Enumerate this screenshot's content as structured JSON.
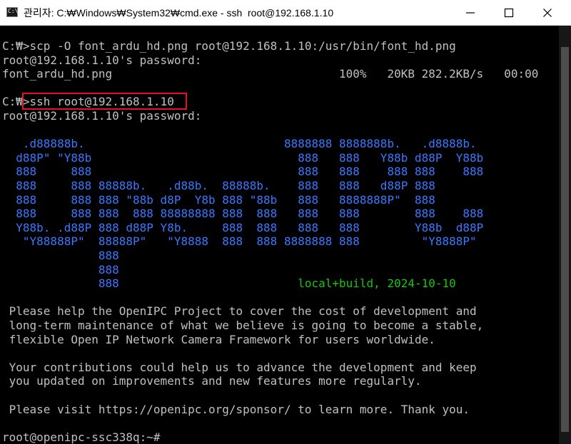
{
  "window": {
    "title": "관리자: C:₩Windows₩System32₩cmd.exe - ssh  root@192.168.1.10",
    "icon": "cmd-icon",
    "icon_text": "C:\\",
    "controls": [
      "minimize-icon",
      "maximize-icon",
      "close-icon"
    ]
  },
  "colors": {
    "background": "#000000",
    "text": "#c0c0c0",
    "banner_blue": "#3b78ff",
    "build_green": "#16c60c",
    "highlight_red": "#e81123"
  },
  "terminal": {
    "lines": [
      {
        "text": "C:₩>scp -O font_ardu_hd.png root@192.168.1.10:/usr/bin/font_hd.png",
        "color": "text"
      },
      {
        "text": "root@192.168.1.10's password:",
        "color": "text"
      },
      {
        "text": "font_ardu_hd.png                                 100%   20KB 282.2KB/s   00:00",
        "color": "text"
      },
      {
        "text": "",
        "color": "text"
      },
      {
        "text": "C:₩>ssh root@192.168.1.10",
        "color": "text"
      },
      {
        "text": "root@192.168.1.10's password:",
        "color": "text"
      },
      {
        "text": "",
        "color": "text"
      },
      {
        "text": "   .d88888b.                             8888888 8888888b.   .d8888b.",
        "color": "banner_blue"
      },
      {
        "text": "  d88P\" \"Y88b                              888   888   Y88b d88P  Y88b",
        "color": "banner_blue"
      },
      {
        "text": "  888     888                              888   888    888 888    888",
        "color": "banner_blue"
      },
      {
        "text": "  888     888 88888b.   .d88b.  88888b.    888   888   d88P 888",
        "color": "banner_blue"
      },
      {
        "text": "  888     888 888 \"88b d8P  Y8b 888 \"88b   888   8888888P\"  888",
        "color": "banner_blue"
      },
      {
        "text": "  888     888 888  888 88888888 888  888   888   888        888    888",
        "color": "banner_blue"
      },
      {
        "text": "  Y88b. .d88P 888 d88P Y8b.     888  888   888   888        Y88b  d88P",
        "color": "banner_blue"
      },
      {
        "text": "   \"Y88888P\"  88888P\"   \"Y8888  888  888 8888888 888         \"Y8888P\"",
        "color": "banner_blue"
      },
      {
        "text": "              888",
        "color": "banner_blue"
      },
      {
        "text": "              888",
        "color": "banner_blue"
      },
      {
        "text": "              888                          local+build, 2024-10-10",
        "color": "build_green",
        "prefix_color": "banner_blue"
      },
      {
        "text": " Please help the OpenIPC Project to cover the cost of development and",
        "color": "text"
      },
      {
        "text": " long-term maintenance of what we believe is going to become a stable,",
        "color": "text"
      },
      {
        "text": " flexible Open IP Network Camera Framework for users worldwide.",
        "color": "text"
      },
      {
        "text": "",
        "color": "text"
      },
      {
        "text": " Your contributions could help us to advance the development and keep",
        "color": "text"
      },
      {
        "text": " you updated on improvements and new features more regularly.",
        "color": "text"
      },
      {
        "text": "",
        "color": "text"
      },
      {
        "text": " Please visit https://openipc.org/sponsor/ to learn more. Thank you.",
        "color": "text"
      },
      {
        "text": "",
        "color": "text"
      },
      {
        "text": "root@openipc-ssc338q:~#",
        "color": "text"
      }
    ]
  }
}
